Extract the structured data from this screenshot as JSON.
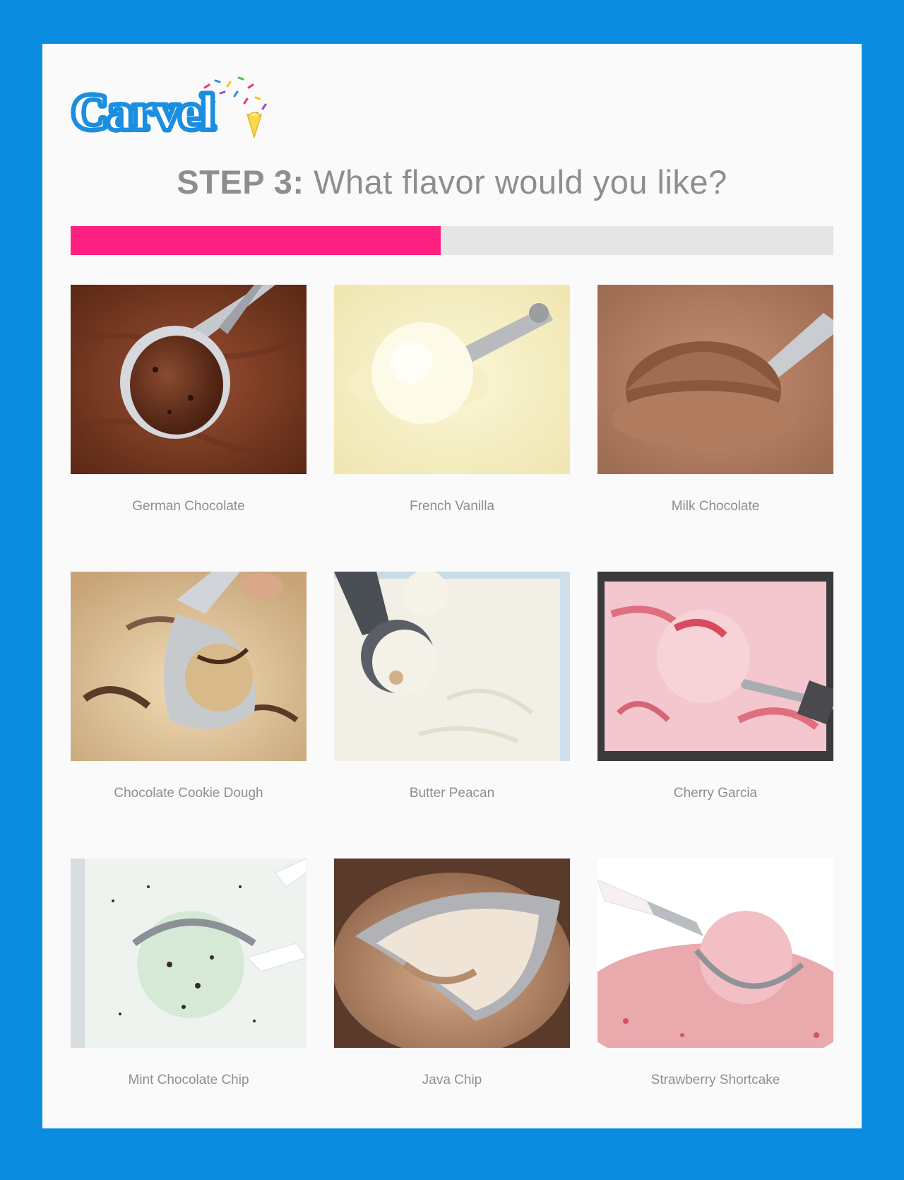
{
  "brand": {
    "logo_text": "Carvel"
  },
  "header": {
    "step_label": "STEP 3:",
    "question": "What flavor would you like?"
  },
  "progress": {
    "fraction": 0.485
  },
  "colors": {
    "page_bg": "#0a8de0",
    "accent": "#ff2181",
    "track": "#e6e5e6",
    "text": "#8e8e8e"
  },
  "flavors": [
    {
      "label": "German Chocolate"
    },
    {
      "label": "French Vanilla"
    },
    {
      "label": "Milk Chocolate"
    },
    {
      "label": "Chocolate Cookie Dough"
    },
    {
      "label": "Butter Peacan"
    },
    {
      "label": "Cherry Garcia"
    },
    {
      "label": "Mint Chocolate Chip"
    },
    {
      "label": "Java Chip"
    },
    {
      "label": "Strawberry Shortcake"
    }
  ]
}
